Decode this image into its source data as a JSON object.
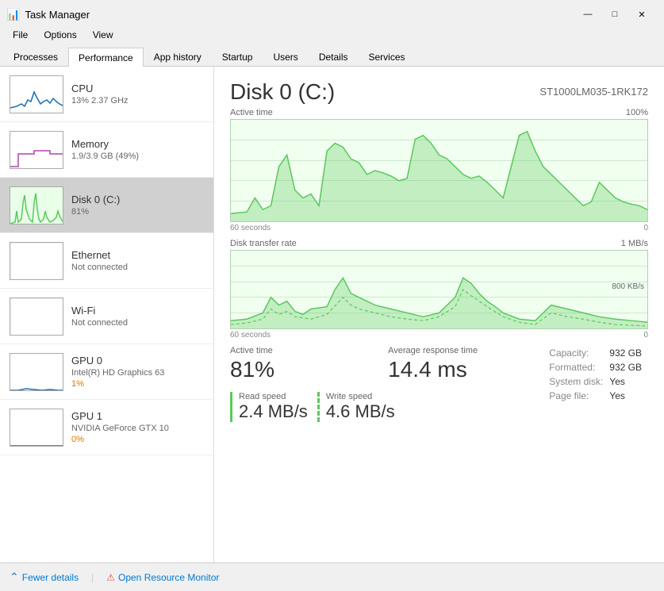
{
  "window": {
    "title": "Task Manager",
    "icon": "📊"
  },
  "menu": {
    "items": [
      "File",
      "Options",
      "View"
    ]
  },
  "tabs": [
    {
      "id": "processes",
      "label": "Processes",
      "active": false
    },
    {
      "id": "performance",
      "label": "Performance",
      "active": true
    },
    {
      "id": "app-history",
      "label": "App history",
      "active": false
    },
    {
      "id": "startup",
      "label": "Startup",
      "active": false
    },
    {
      "id": "users",
      "label": "Users",
      "active": false
    },
    {
      "id": "details",
      "label": "Details",
      "active": false
    },
    {
      "id": "services",
      "label": "Services",
      "active": false
    }
  ],
  "sidebar": {
    "items": [
      {
        "id": "cpu",
        "name": "CPU",
        "detail": "13%  2.37 GHz",
        "detail_color": "normal",
        "active": false,
        "chart_type": "cpu"
      },
      {
        "id": "memory",
        "name": "Memory",
        "detail": "1.9/3.9 GB (49%)",
        "detail_color": "normal",
        "active": false,
        "chart_type": "memory"
      },
      {
        "id": "disk0",
        "name": "Disk 0 (C:)",
        "detail": "81%",
        "detail_color": "normal",
        "active": true,
        "chart_type": "disk"
      },
      {
        "id": "ethernet",
        "name": "Ethernet",
        "detail": "Not connected",
        "detail_color": "normal",
        "active": false,
        "chart_type": "empty"
      },
      {
        "id": "wifi",
        "name": "Wi-Fi",
        "detail": "Not connected",
        "detail_color": "normal",
        "active": false,
        "chart_type": "empty"
      },
      {
        "id": "gpu0",
        "name": "GPU 0",
        "detail_line1": "Intel(R) HD Graphics 63",
        "detail": "1%",
        "detail_color": "orange",
        "active": false,
        "chart_type": "gpu"
      },
      {
        "id": "gpu1",
        "name": "GPU 1",
        "detail_line1": "NVIDIA GeForce GTX 10",
        "detail": "0%",
        "detail_color": "orange",
        "active": false,
        "chart_type": "gpu"
      }
    ]
  },
  "panel": {
    "title": "Disk 0 (C:)",
    "model": "ST1000LM035-1RK172",
    "chart1": {
      "label": "Active time",
      "max_label": "100%",
      "time_left": "60 seconds",
      "time_right": "0"
    },
    "chart2": {
      "label": "Disk transfer rate",
      "max_label": "1 MB/s",
      "max_label2": "800 KB/s",
      "time_left": "60 seconds",
      "time_right": "0"
    },
    "stats": {
      "active_time_label": "Active time",
      "active_time_value": "81%",
      "avg_response_label": "Average response time",
      "avg_response_value": "14.4 ms",
      "read_speed_label": "Read speed",
      "read_speed_value": "2.4 MB/s",
      "write_speed_label": "Write speed",
      "write_speed_value": "4.6 MB/s",
      "capacity_label": "Capacity:",
      "capacity_value": "932 GB",
      "formatted_label": "Formatted:",
      "formatted_value": "932 GB",
      "system_disk_label": "System disk:",
      "system_disk_value": "Yes",
      "page_file_label": "Page file:",
      "page_file_value": "Yes"
    }
  },
  "bottombar": {
    "fewer_details_label": "Fewer details",
    "open_resource_monitor_label": "Open Resource Monitor"
  },
  "colors": {
    "green": "#5bc85b",
    "blue": "#0078d4",
    "orange": "#d97706",
    "purple": "#b044b0",
    "chart_bg": "#f0fff0",
    "chart_line": "#5bc85b",
    "chart_border": "#b0d0b0"
  }
}
